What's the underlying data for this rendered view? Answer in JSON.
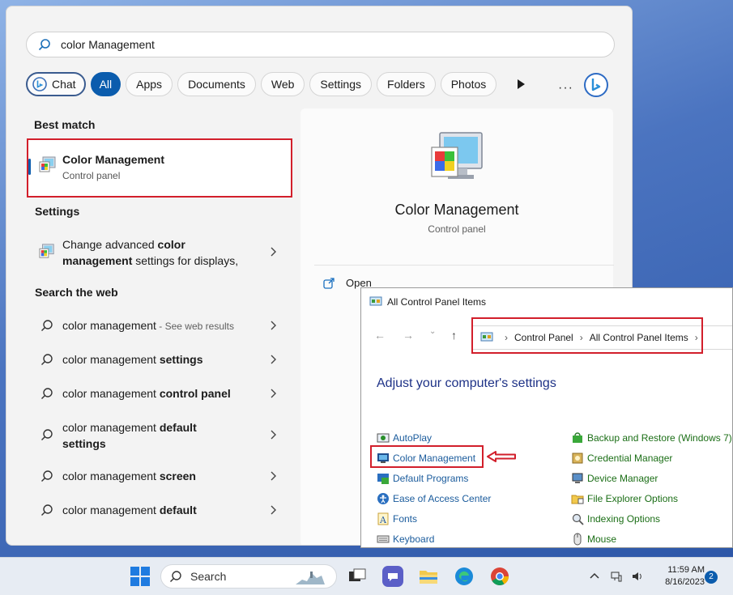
{
  "search": {
    "query": "color Management"
  },
  "filters": [
    "Chat",
    "All",
    "Apps",
    "Documents",
    "Web",
    "Settings",
    "Folders",
    "Photos"
  ],
  "more_label": "···",
  "best_match": {
    "heading": "Best match",
    "title": "Color Management",
    "subtitle": "Control panel"
  },
  "settings": {
    "heading": "Settings",
    "line1_pre": "Change advanced ",
    "line1_bold": "color",
    "line2_bold": "management",
    "line2_post": " settings for displays,"
  },
  "web": {
    "heading": "Search the web",
    "results": [
      {
        "plain": "color management",
        "bold": "",
        "muted": " - See web results"
      },
      {
        "plain": "color management ",
        "bold": "settings",
        "muted": ""
      },
      {
        "plain": "color management ",
        "bold": "control panel",
        "muted": ""
      },
      {
        "plain": "color management ",
        "bold": "default",
        "muted": "",
        "line2": "settings"
      },
      {
        "plain": "color management ",
        "bold": "screen",
        "muted": ""
      },
      {
        "plain": "color management ",
        "bold": "default",
        "muted": ""
      }
    ]
  },
  "preview": {
    "title": "Color Management",
    "subtitle": "Control panel",
    "open_label": "Open"
  },
  "control_panel": {
    "window_title": "All Control Panel Items",
    "breadcrumb": [
      "Control Panel",
      "All Control Panel Items"
    ],
    "heading": "Adjust your computer's settings",
    "left_items": [
      "AutoPlay",
      "Color Management",
      "Default Programs",
      "Ease of Access Center",
      "Fonts",
      "Keyboard"
    ],
    "right_items": [
      "Backup and Restore (Windows 7)",
      "Credential Manager",
      "Device Manager",
      "File Explorer Options",
      "Indexing Options",
      "Mouse"
    ]
  },
  "taskbar": {
    "search_label": "Search",
    "time": "11:59 AM",
    "date": "8/16/2023",
    "notification_count": "2"
  },
  "colors": {
    "accent": "#0b5cad",
    "highlight_box": "#d21f2b",
    "link_blue": "#1a5b9c",
    "link_green": "#1b6e16"
  }
}
